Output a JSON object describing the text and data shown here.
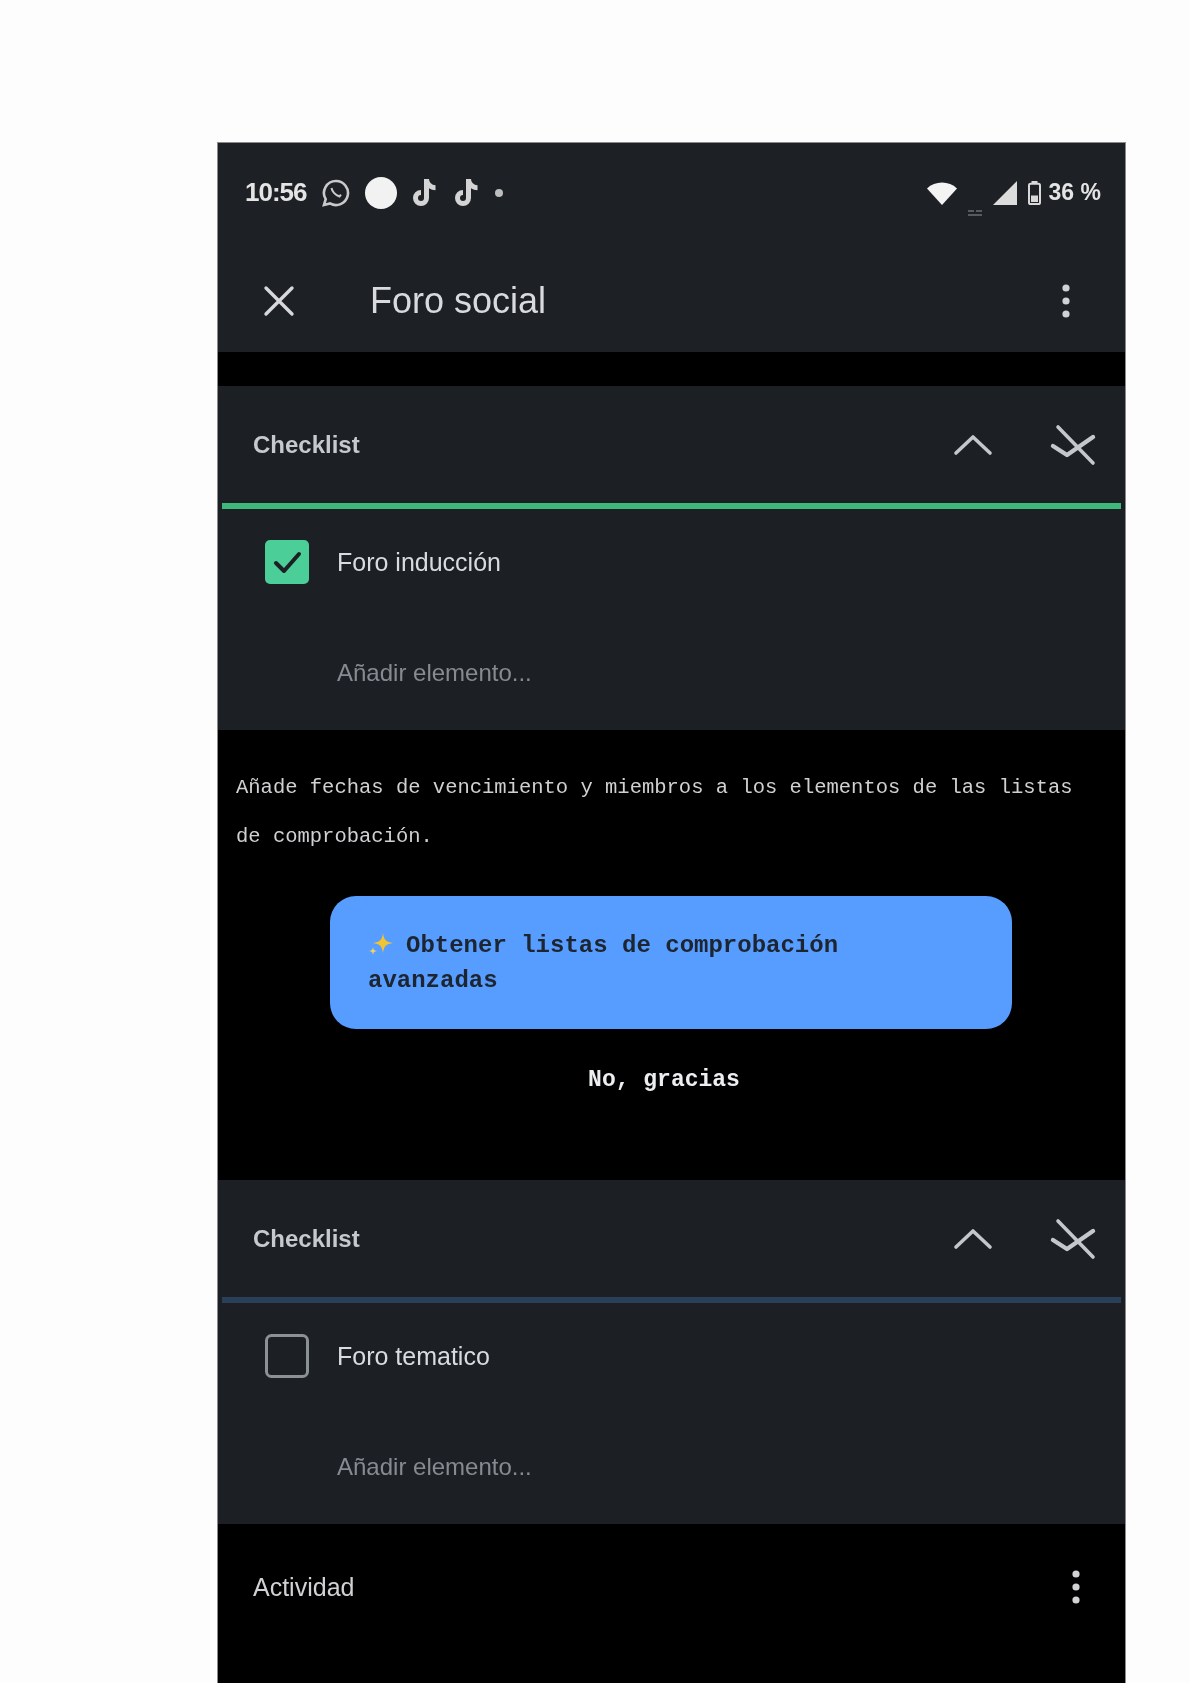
{
  "status_bar": {
    "time": "10:56",
    "battery": "36 %"
  },
  "app_bar": {
    "title": "Foro social"
  },
  "sections": [
    {
      "kind": "checklist",
      "title": "Checklist",
      "expanded": true,
      "level": 1,
      "items": [
        {
          "label": "Foro inducción",
          "checked": true
        }
      ],
      "add_field": {
        "placeholder": "Añadir elemento..."
      }
    },
    {
      "kind": "upsell",
      "text": "Añade fechas de vencimiento y miembros a los elementos de las listas de comprobación.",
      "button": "Obtener listas de comprobación avanzadas",
      "dismiss": "No, gracias"
    },
    {
      "kind": "checklist",
      "title": "Checklist",
      "expanded": true,
      "level": 0,
      "items": [
        {
          "label": "Foro tematico",
          "checked": false
        }
      ],
      "add_field": {
        "placeholder": "Añadir elemento..."
      }
    },
    {
      "kind": "activity",
      "title": "Actividad"
    }
  ]
}
